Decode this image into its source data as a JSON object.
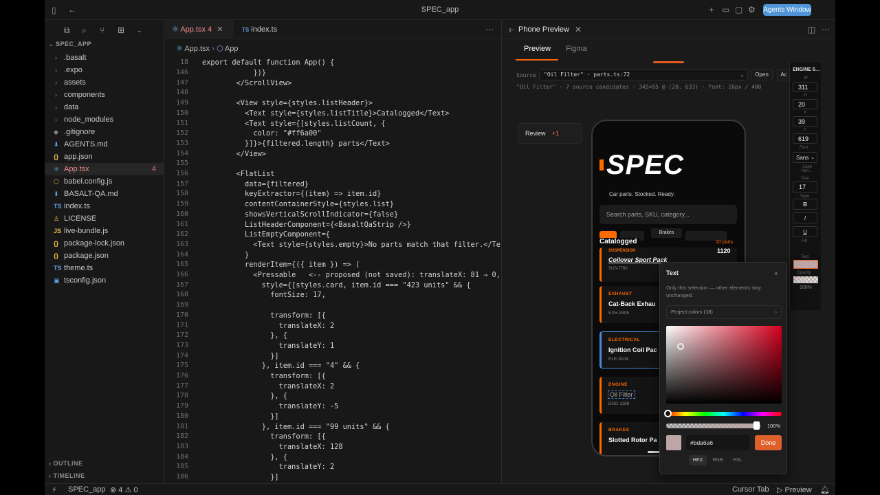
{
  "window": {
    "title": "SPEC_app",
    "agents_button": "Agents Window"
  },
  "sidebar": {
    "root": "SPEC_APP",
    "items": [
      {
        "label": ".basalt",
        "kind": "folder"
      },
      {
        "label": ".expo",
        "kind": "folder"
      },
      {
        "label": "assets",
        "kind": "folder"
      },
      {
        "label": "components",
        "kind": "folder"
      },
      {
        "label": "data",
        "kind": "folder"
      },
      {
        "label": "node_modules",
        "kind": "folder"
      },
      {
        "label": ".gitignore",
        "kind": "file",
        "icon": "◆"
      },
      {
        "label": "AGENTS.md",
        "kind": "file",
        "icon": "⬇"
      },
      {
        "label": "app.json",
        "kind": "file",
        "icon": "{}"
      },
      {
        "label": "App.tsx",
        "kind": "file",
        "icon": "⚛",
        "badge": "4",
        "active": true
      },
      {
        "label": "babel.config.js",
        "kind": "file",
        "icon": "⬡"
      },
      {
        "label": "BASALT-QA.md",
        "kind": "file",
        "icon": "⬇"
      },
      {
        "label": "index.ts",
        "kind": "file",
        "icon": "TS"
      },
      {
        "label": "LICENSE",
        "kind": "file",
        "icon": "♙"
      },
      {
        "label": "live-bundle.js",
        "kind": "file",
        "icon": "JS"
      },
      {
        "label": "package-lock.json",
        "kind": "file",
        "icon": "{}"
      },
      {
        "label": "package.json",
        "kind": "file",
        "icon": "{}"
      },
      {
        "label": "theme.ts",
        "kind": "file",
        "icon": "TS"
      },
      {
        "label": "tsconfig.json",
        "kind": "file",
        "icon": "▣"
      }
    ],
    "outline": "OUTLINE",
    "timeline": "TIMELINE"
  },
  "editor": {
    "tabs": [
      {
        "label": "App.tsx",
        "badge": "4"
      },
      {
        "label": "index.ts"
      }
    ],
    "breadcrumb": [
      "App.tsx",
      "App"
    ],
    "sticky_line": {
      "n": "18",
      "text": "export default function App() {"
    },
    "lines": [
      [
        "146",
        "            })}"
      ],
      [
        "147",
        "        </ScrollView>"
      ],
      [
        "148",
        ""
      ],
      [
        "149",
        "        <View style={styles.listHeader}>"
      ],
      [
        "150",
        "          <Text style={styles.listTitle}>Catalogged</Text>"
      ],
      [
        "151",
        "          <Text style={[styles.listCount, {"
      ],
      [
        "152",
        "            color: \"#ff6a00\""
      ],
      [
        "153",
        "          }]}>{filtered.length} parts</Text>"
      ],
      [
        "154",
        "        </View>"
      ],
      [
        "155",
        ""
      ],
      [
        "156",
        "        <FlatList"
      ],
      [
        "157",
        "          data={filtered}"
      ],
      [
        "158",
        "          keyExtractor={(item) => item.id}"
      ],
      [
        "159",
        "          contentContainerStyle={styles.list}"
      ],
      [
        "160",
        "          showsVerticalScrollIndicator={false}"
      ],
      [
        "161",
        "          ListHeaderComponent={<BasaltQaStrip />}"
      ],
      [
        "162",
        "          ListEmptyComponent={"
      ],
      [
        "163",
        "            <Text style={styles.empty}>No parts match that filter.</Text>"
      ],
      [
        "164",
        "          }"
      ],
      [
        "165",
        "          renderItem={({ item }) => ("
      ],
      [
        "166",
        "            <Pressable   <-- proposed (not saved): translateX: 81 → 0, tra"
      ],
      [
        "167",
        "              style={[styles.card, item.id === \"423 units\" && {"
      ],
      [
        "168",
        "                fontSize: 17,"
      ],
      [
        "169",
        ""
      ],
      [
        "170",
        "                transform: [{"
      ],
      [
        "171",
        "                  translateX: 2"
      ],
      [
        "172",
        "                }, {"
      ],
      [
        "173",
        "                  translateY: 1"
      ],
      [
        "174",
        "                }]"
      ],
      [
        "175",
        "              }, item.id === \"4\" && {"
      ],
      [
        "176",
        "                transform: [{"
      ],
      [
        "177",
        "                  translateX: 2"
      ],
      [
        "178",
        "                }, {"
      ],
      [
        "179",
        "                  translateY: -5"
      ],
      [
        "180",
        "                }]"
      ],
      [
        "181",
        "              }, item.id === \"99 units\" && {"
      ],
      [
        "182",
        "                transform: [{"
      ],
      [
        "183",
        "                  translateX: 128"
      ],
      [
        "184",
        "                }, {"
      ],
      [
        "185",
        "                  translateY: 2"
      ],
      [
        "186",
        "                }]"
      ]
    ]
  },
  "preview": {
    "tab_title": "Phone Preview",
    "subtabs": [
      "Preview",
      "Figma"
    ],
    "source_label": "Source",
    "source_value": "\"Oil Filter\" · parts.ts:72",
    "open_btn": "Open",
    "apply_btn": "Ac",
    "info_line": "\"Oil Filter\" · 7 source candidates · 345×95 @ (20, 633) · font: 16px / 400",
    "review": {
      "label": "Review",
      "count": "+1"
    },
    "inspector": {
      "title": "ENGINE 6…",
      "fields": [
        {
          "label": "W",
          "value": "311"
        },
        {
          "label": "H",
          "value": "20"
        },
        {
          "label": "X",
          "value": "39"
        },
        {
          "label": "Y",
          "value": "619"
        }
      ],
      "font_label": "Font",
      "font_value": "Sans",
      "load_label": "Load font…",
      "size_label": "Size",
      "size_value": "17",
      "style_label": "Style",
      "style_buttons": [
        "B",
        "I",
        "U"
      ],
      "fill_label": "Fill",
      "text_label": "Text",
      "opacity_label": "Opacity",
      "opacity_value": "100%"
    },
    "phone": {
      "brand": "SPEC",
      "tagline": "Car parts. Stocked. Ready.",
      "search_placeholder": "Search parts, SKU, category...",
      "chips": [
        "",
        "Brakes",
        "",
        ""
      ],
      "list_title": "Catalogged",
      "list_count": "10 parts",
      "first_card_category": "SUSPENSION",
      "first_card_price": "1120",
      "first_card_title": "Coilover Sport Pack",
      "first_card_sku": "SUS-7780",
      "cards": [
        {
          "category": "EXHAUST",
          "title": "Cat-Back Exhau",
          "sku": "EXH-3305"
        },
        {
          "category": "ELECTRICAL",
          "title": "Ignition Coil Pac",
          "sku": "ELE-9104"
        },
        {
          "category": "ENGINE",
          "title": "Oil Filter",
          "sku": "ENG-1188"
        },
        {
          "category": "BRAKES",
          "title": "Slotted Rotor Pa",
          "sku": ""
        }
      ]
    },
    "popup": {
      "title": "Text",
      "note": "Only this selection — other elements stay unchanged.",
      "project_colors": "Project colors (18)",
      "alpha": "100%",
      "hex": "#bda6a6",
      "done": "Done",
      "modes": [
        "HEX",
        "RGB",
        "HSL"
      ]
    }
  },
  "status": {
    "branch": "SPEC_app",
    "errors": "4",
    "warnings": "0",
    "cursor_tab": "Cursor Tab",
    "preview": "Preview"
  },
  "colors": {
    "accent": "#ff6a00",
    "swatch": "#bda6a6",
    "done": "#e0602c",
    "agents": "#4f95d8"
  }
}
